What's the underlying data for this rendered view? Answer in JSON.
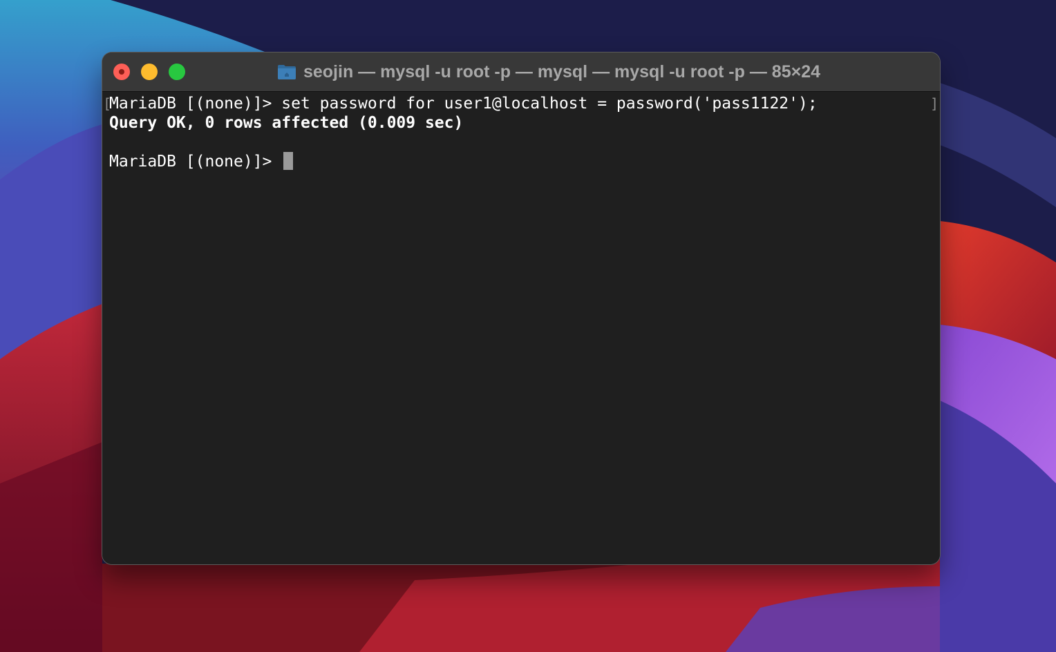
{
  "window": {
    "title": "seojin — mysql -u root -p — mysql — mysql -u root -p — 85×24",
    "icon": "folder-home-icon"
  },
  "terminal": {
    "lines": [
      "MariaDB [(none)]> set password for user1@localhost = password('pass1122');",
      "Query OK, 0 rows affected (0.009 sec)",
      "",
      "MariaDB [(none)]> "
    ],
    "marks": {
      "left": "[",
      "right": "]"
    }
  },
  "colors": {
    "close": "#fe5f57",
    "minimize": "#febc2e",
    "zoom": "#28c840",
    "terminal_bg": "#1f1f1f",
    "titlebar_bg": "#383838"
  }
}
